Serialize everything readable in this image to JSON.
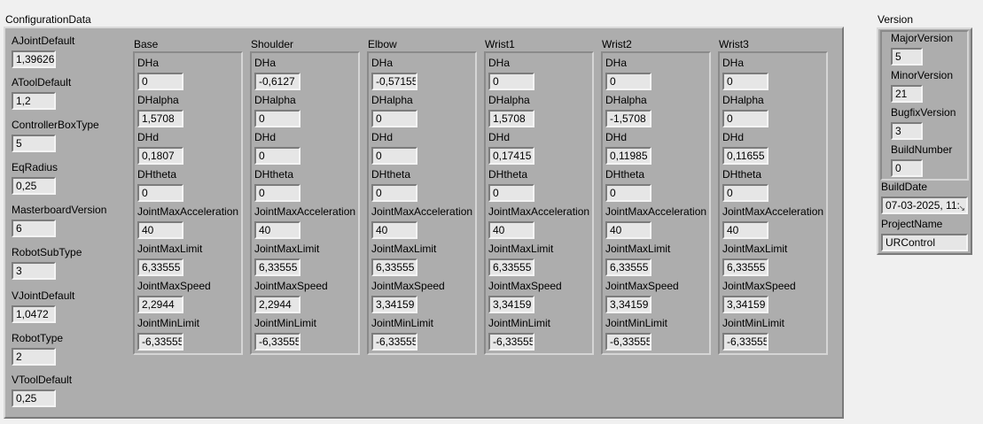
{
  "configuration": {
    "title": "ConfigurationData",
    "fields": [
      {
        "label": "AJointDefault",
        "value": "1,39626"
      },
      {
        "label": "AToolDefault",
        "value": "1,2"
      },
      {
        "label": "ControllerBoxType",
        "value": "5"
      },
      {
        "label": "EqRadius",
        "value": "0,25"
      },
      {
        "label": "MasterboardVersion",
        "value": "6"
      },
      {
        "label": "RobotSubType",
        "value": "3"
      },
      {
        "label": "VJointDefault",
        "value": "1,0472"
      },
      {
        "label": "RobotType",
        "value": "2"
      },
      {
        "label": "VToolDefault",
        "value": "0,25"
      }
    ],
    "joints": [
      {
        "name": "Base",
        "params": [
          {
            "label": "DHa",
            "value": "0"
          },
          {
            "label": "DHalpha",
            "value": "1,5708"
          },
          {
            "label": "DHd",
            "value": "0,1807"
          },
          {
            "label": "DHtheta",
            "value": "0"
          },
          {
            "label": "JointMaxAcceleration",
            "value": "40"
          },
          {
            "label": "JointMaxLimit",
            "value": "6,33555"
          },
          {
            "label": "JointMaxSpeed",
            "value": "2,2944"
          },
          {
            "label": "JointMinLimit",
            "value": "-6,33555"
          }
        ]
      },
      {
        "name": "Shoulder",
        "params": [
          {
            "label": "DHa",
            "value": "-0,6127"
          },
          {
            "label": "DHalpha",
            "value": "0"
          },
          {
            "label": "DHd",
            "value": "0"
          },
          {
            "label": "DHtheta",
            "value": "0"
          },
          {
            "label": "JointMaxAcceleration",
            "value": "40"
          },
          {
            "label": "JointMaxLimit",
            "value": "6,33555"
          },
          {
            "label": "JointMaxSpeed",
            "value": "2,2944"
          },
          {
            "label": "JointMinLimit",
            "value": "-6,33555"
          }
        ]
      },
      {
        "name": "Elbow",
        "params": [
          {
            "label": "DHa",
            "value": "-0,57155"
          },
          {
            "label": "DHalpha",
            "value": "0"
          },
          {
            "label": "DHd",
            "value": "0"
          },
          {
            "label": "DHtheta",
            "value": "0"
          },
          {
            "label": "JointMaxAcceleration",
            "value": "40"
          },
          {
            "label": "JointMaxLimit",
            "value": "6,33555"
          },
          {
            "label": "JointMaxSpeed",
            "value": "3,34159"
          },
          {
            "label": "JointMinLimit",
            "value": "-6,33555"
          }
        ]
      },
      {
        "name": "Wrist1",
        "params": [
          {
            "label": "DHa",
            "value": "0"
          },
          {
            "label": "DHalpha",
            "value": "1,5708"
          },
          {
            "label": "DHd",
            "value": "0,17415"
          },
          {
            "label": "DHtheta",
            "value": "0"
          },
          {
            "label": "JointMaxAcceleration",
            "value": "40"
          },
          {
            "label": "JointMaxLimit",
            "value": "6,33555"
          },
          {
            "label": "JointMaxSpeed",
            "value": "3,34159"
          },
          {
            "label": "JointMinLimit",
            "value": "-6,33555"
          }
        ]
      },
      {
        "name": "Wrist2",
        "params": [
          {
            "label": "DHa",
            "value": "0"
          },
          {
            "label": "DHalpha",
            "value": "-1,5708"
          },
          {
            "label": "DHd",
            "value": "0,11985"
          },
          {
            "label": "DHtheta",
            "value": "0"
          },
          {
            "label": "JointMaxAcceleration",
            "value": "40"
          },
          {
            "label": "JointMaxLimit",
            "value": "6,33555"
          },
          {
            "label": "JointMaxSpeed",
            "value": "3,34159"
          },
          {
            "label": "JointMinLimit",
            "value": "-6,33555"
          }
        ]
      },
      {
        "name": "Wrist3",
        "params": [
          {
            "label": "DHa",
            "value": "0"
          },
          {
            "label": "DHalpha",
            "value": "0"
          },
          {
            "label": "DHd",
            "value": "0,11655"
          },
          {
            "label": "DHtheta",
            "value": "0"
          },
          {
            "label": "JointMaxAcceleration",
            "value": "40"
          },
          {
            "label": "JointMaxLimit",
            "value": "6,33555"
          },
          {
            "label": "JointMaxSpeed",
            "value": "3,34159"
          },
          {
            "label": "JointMinLimit",
            "value": "-6,33555"
          }
        ]
      }
    ]
  },
  "version": {
    "title": "Version",
    "fields": [
      {
        "label": "MajorVersion",
        "value": "5"
      },
      {
        "label": "MinorVersion",
        "value": "21"
      },
      {
        "label": "BugfixVersion",
        "value": "3"
      },
      {
        "label": "BuildNumber",
        "value": "0"
      }
    ],
    "build_date": {
      "label": "BuildDate",
      "value": "07-03-2025, 11:"
    },
    "project_name": {
      "label": "ProjectName",
      "value": "URControl"
    },
    "resize_icon": "resize-corner-icon"
  }
}
